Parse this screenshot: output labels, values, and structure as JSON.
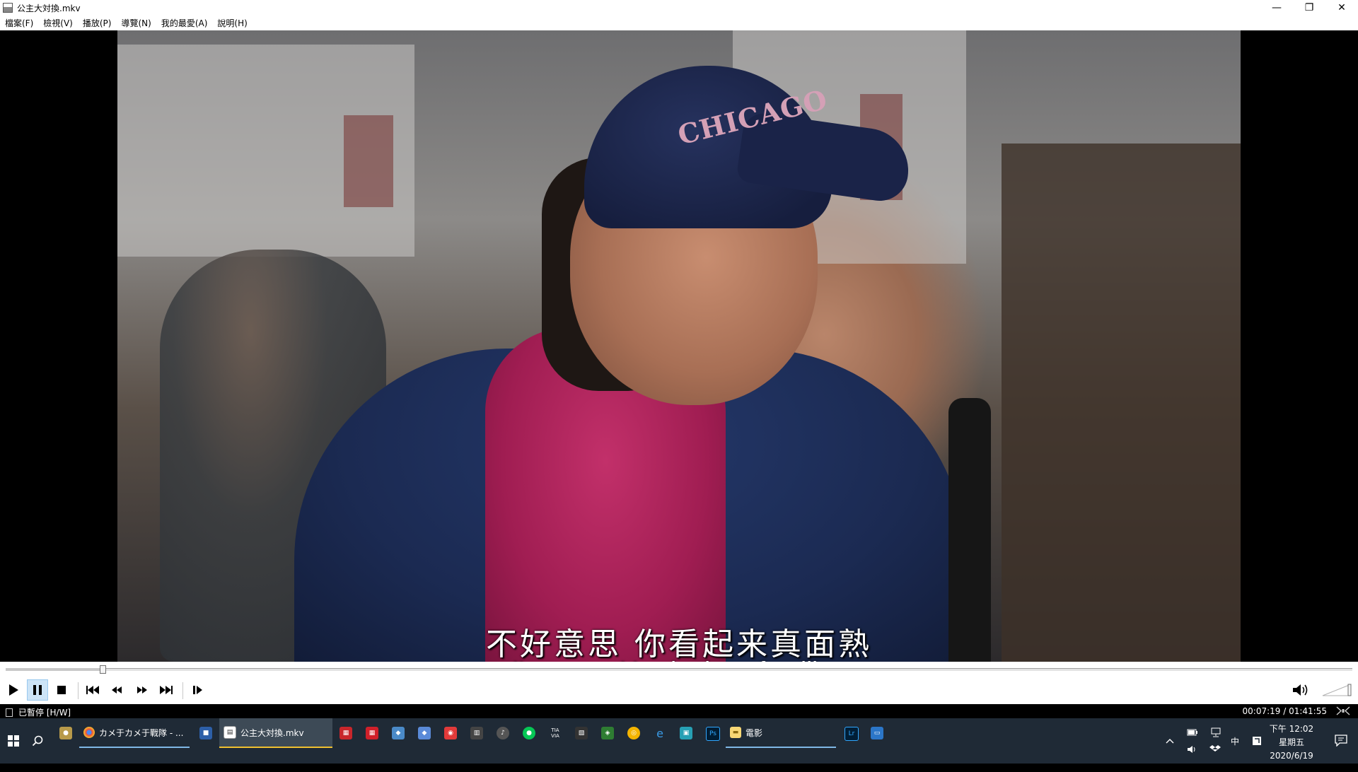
{
  "window": {
    "title": "公主大対換.mkv",
    "controls": {
      "minimize": "—",
      "restore": "❐",
      "close": "✕"
    }
  },
  "menu": [
    "檔案(F)",
    "檢視(V)",
    "播放(P)",
    "導覽(N)",
    "我的最愛(A)",
    "說明(H)"
  ],
  "video": {
    "cap_text": "CHICAGO",
    "subtitle_cn": "不好意思  你看起来真面熟",
    "subtitle_en": "I'm sorry. You look so familiar."
  },
  "seek": {
    "progress_fraction": 0.0722
  },
  "toolbar": {
    "buttons": [
      {
        "name": "play-icon",
        "state": "normal"
      },
      {
        "name": "pause-icon",
        "state": "active"
      },
      {
        "name": "stop-icon",
        "state": "normal"
      },
      {
        "name": "previous-icon",
        "state": "normal"
      },
      {
        "name": "rewind-icon",
        "state": "normal"
      },
      {
        "name": "fast-forward-icon",
        "state": "normal"
      },
      {
        "name": "next-icon",
        "state": "normal"
      },
      {
        "name": "frame-step-icon",
        "state": "normal"
      }
    ],
    "volume_icon": "speaker-icon"
  },
  "status": {
    "state_text": "已暫停 [H/W]",
    "time_text": "00:07:19 / 01:41:55"
  },
  "taskbar": {
    "apps": [
      {
        "label": "カメ于カメ于戰隊 - ...",
        "icon": "chrome-icon",
        "state": "open"
      },
      {
        "label": "公主大対換.mkv",
        "icon": "player-icon",
        "state": "current"
      },
      {
        "label": "電影",
        "icon": "folder-icon",
        "state": "open"
      }
    ],
    "pinned_labels": {
      "tv": "TIA VIA",
      "lr": "Lr",
      "ps": "Ps"
    },
    "tray": {
      "ime": "中",
      "time_line1": "下午 12:02",
      "time_line2": "星期五",
      "date": "2020/6/19"
    }
  },
  "colors": {
    "taskbar_bg": "#1f2a36",
    "current_app_underline": "#f0c030",
    "open_app_underline": "#7fb8e6",
    "pause_active_bg": "#cce4f7"
  }
}
